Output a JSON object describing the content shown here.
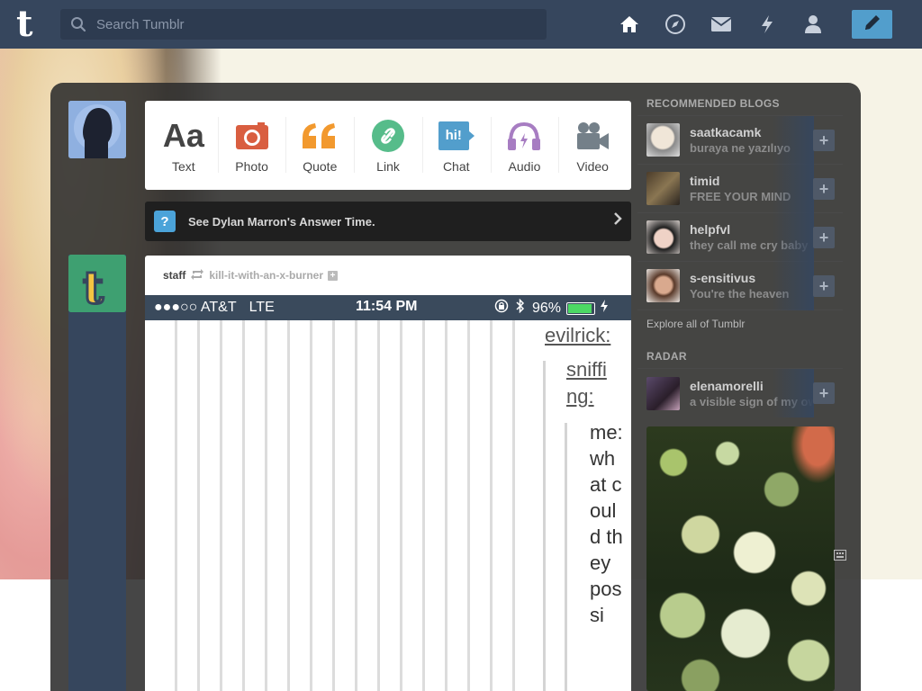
{
  "header": {
    "logo": "t",
    "search_placeholder": "Search Tumblr",
    "nav": [
      "home-icon",
      "explore-compass-icon",
      "messages-icon",
      "activity-bolt-icon",
      "account-icon"
    ],
    "compose_icon": "pencil-icon"
  },
  "post_types": [
    {
      "label": "Text",
      "icon": "text-aa-icon"
    },
    {
      "label": "Photo",
      "icon": "camera-icon"
    },
    {
      "label": "Quote",
      "icon": "quote-icon"
    },
    {
      "label": "Link",
      "icon": "link-icon"
    },
    {
      "label": "Chat",
      "icon": "chat-icon",
      "glyph": "hi!"
    },
    {
      "label": "Audio",
      "icon": "headphones-icon"
    },
    {
      "label": "Video",
      "icon": "video-camera-icon"
    }
  ],
  "text_glyph": "Aa",
  "banner": {
    "text": "See Dylan Marron's Answer Time.",
    "icon_glyph": "?"
  },
  "post": {
    "author": "staff",
    "reblogged_from": "kill-it-with-an-x-burner",
    "status_bar": {
      "carrier": "●●●○○ AT&T",
      "network": "LTE",
      "time": "11:54 PM",
      "battery": "96%"
    },
    "conversation": {
      "user1": "evilrick:",
      "user2": "sniffi ng:",
      "message": "me: what could they possi"
    }
  },
  "sidebar": {
    "recommended_title": "RECOMMENDED BLOGS",
    "recommended": [
      {
        "name": "saatkacamk",
        "subtitle": "buraya ne yazılıyo"
      },
      {
        "name": "timid",
        "subtitle": "FREE YOUR MIND"
      },
      {
        "name": "helpfvl",
        "subtitle": "they call me cry baby"
      },
      {
        "name": "s-ensitivus",
        "subtitle": "You're the heaven"
      }
    ],
    "explore_link": "Explore all of Tumblr",
    "radar_title": "RADAR",
    "radar": {
      "name": "elenamorelli",
      "subtitle": "a visible sign of my ow"
    }
  },
  "colors": {
    "header_bg": "#36465d",
    "compose_bg": "#529ecc",
    "photo": "#d95e40",
    "quote": "#f2992e",
    "link": "#56bc8a",
    "chat": "#529ecc",
    "audio": "#a77dc2",
    "video": "#748089"
  }
}
